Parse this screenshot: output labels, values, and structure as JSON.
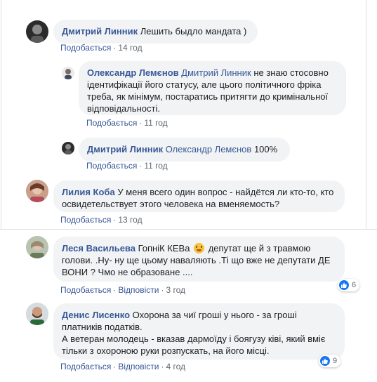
{
  "comments": [
    {
      "author": "Дмитрий Линник",
      "text": "Лешить быдло мандата )",
      "like_label": "Подобається",
      "time": "14 год",
      "replies": [
        {
          "author": "Олександр Лемєнов",
          "mention": "Дмитрий Линник",
          "text": "не знаю стосовно ідентифікації його статусу, але цього політичного фріка треба, як мінімум, постаратись притягти до кримінальної відповідальності.",
          "like_label": "Подобається",
          "time": "11 год"
        },
        {
          "author": "Дмитрий Линник",
          "mention": "Олександр Лемєнов",
          "text": "100%",
          "like_label": "Подобається",
          "time": "11 год"
        }
      ]
    },
    {
      "author": "Лилия Коба",
      "text": "У меня всего один вопрос - найдётся ли кто-то, кто освидетельствует этого человека на вменяемость?",
      "like_label": "Подобається",
      "time": "13 год"
    },
    {
      "author": "Леся Васильева",
      "text_before_emoji": "ГопніК КЕВа",
      "emoji": "flushed-face",
      "text_after_emoji": "депутат ще й з травмою голови. .Ну- ну ще цьому наваляють .Ті що вже не депутати ДЕ ВОНИ ? Чмо не образоване ....",
      "like_label": "Подобається",
      "reply_label": "Відповісти",
      "time": "3 год",
      "reaction_count": "6"
    },
    {
      "author": "Денис Лисенко",
      "text": "Охорона за чиї гроші у нього - за гроші платників податків.",
      "text2": "А ветеран молодець - вказав дармоїду і боягузу ківі, який вміє тільки з охороною руки розпускать, на його місці.",
      "like_label": "Подобається",
      "reply_label": "Відповісти",
      "time": "4 год",
      "reaction_count": "9"
    }
  ],
  "colors": {
    "link": "#385898",
    "bubble": "#f2f3f5",
    "meta": "#606770",
    "like": "#1877f2"
  },
  "separator": "·"
}
